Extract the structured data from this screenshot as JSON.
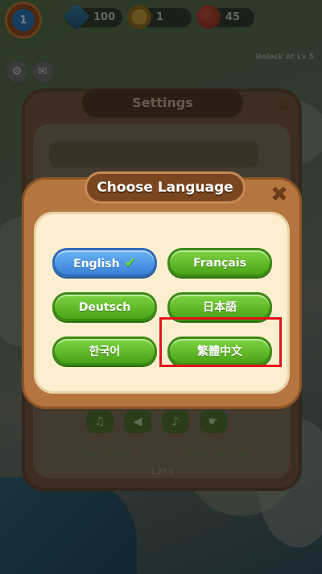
{
  "hud": {
    "level": "1",
    "gems": "100",
    "coins": "1",
    "energy": "45",
    "unlock_text": "Unlock At Lv 5"
  },
  "settings": {
    "title": "Settings",
    "clear_cache": "Clear Cache",
    "privacy_settings": "Privacy Settings",
    "version": "1.27.0"
  },
  "language_dialog": {
    "title": "Choose Language",
    "selected": "English",
    "options": [
      {
        "label": "English",
        "color": "#3a82d8"
      },
      {
        "label": "Français",
        "color": "#4aa317"
      },
      {
        "label": "Deutsch",
        "color": "#4aa317"
      },
      {
        "label": "日本語",
        "color": "#4aa317"
      },
      {
        "label": "한국어",
        "color": "#4aa317"
      },
      {
        "label": "繁體中文",
        "color": "#4aa317"
      }
    ]
  },
  "icons": {
    "close": "close-icon",
    "check": "checkmark-icon"
  },
  "colors": {
    "highlight": "#e0141b",
    "selected_button": "#3a82d8",
    "button": "#4aa317",
    "dialog_frame": "#b4753f",
    "dialog_body": "#fcefd0"
  }
}
